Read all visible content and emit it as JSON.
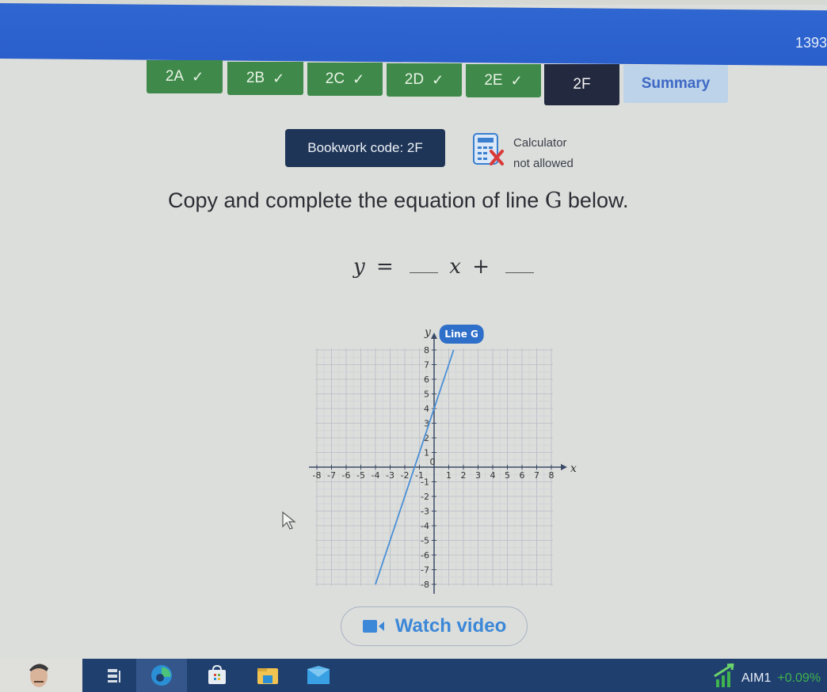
{
  "header": {
    "number_readout": "1393"
  },
  "tabs": [
    {
      "label": "2A",
      "status": "done",
      "check_icon": "checkmark-icon"
    },
    {
      "label": "2B",
      "status": "done",
      "check_icon": "checkmark-icon"
    },
    {
      "label": "2C",
      "status": "done",
      "check_icon": "checkmark-icon"
    },
    {
      "label": "2D",
      "status": "done",
      "check_icon": "checkmark-icon"
    },
    {
      "label": "2E",
      "status": "done",
      "check_icon": "checkmark-icon"
    },
    {
      "label": "2F",
      "status": "current"
    },
    {
      "label": "Summary",
      "status": "summary"
    }
  ],
  "bookwork": {
    "label": "Bookwork code: 2F"
  },
  "calculator": {
    "icon": "calculator-not-allowed-icon",
    "line1": "Calculator",
    "line2": "not allowed"
  },
  "question": {
    "text_before": "Copy and complete the equation of line ",
    "line_name": "G",
    "text_after": " below."
  },
  "equation": {
    "lhs": "y",
    "equals": "=",
    "variable": "x",
    "plus": "+"
  },
  "video_button": {
    "label": "Watch video",
    "icon": "video-camera-icon"
  },
  "colors": {
    "header_blue": "#2f66d0",
    "tab_done": "#3f8a4a",
    "tab_current": "#232a3f",
    "tab_summary": "#bcd3ea",
    "bookwork_bg": "#1f3557",
    "line_color": "#4a8fd6",
    "label_bg": "#2e6fc9",
    "video_blue": "#3b87d8"
  },
  "taskbar": {
    "icons": [
      "task-view-icon",
      "edge-browser-icon",
      "store-icon",
      "file-explorer-icon",
      "mail-icon"
    ],
    "stock_ticker": "AIM1",
    "stock_change": "+0.09%"
  },
  "chart_data": {
    "type": "line",
    "title": "",
    "xlabel": "x",
    "ylabel": "y",
    "xlim": [
      -8,
      8
    ],
    "ylim": [
      -8,
      8
    ],
    "x_ticks": [
      "-8",
      "-7",
      "-6",
      "-5",
      "-4",
      "-3",
      "-2",
      "-1",
      "0",
      "1",
      "2",
      "3",
      "4",
      "5",
      "6",
      "7",
      "8"
    ],
    "y_ticks": [
      "8",
      "7",
      "6",
      "5",
      "4",
      "3",
      "2",
      "1",
      "-1",
      "-2",
      "-3",
      "-4",
      "-5",
      "-6",
      "-7",
      "-8"
    ],
    "grid": true,
    "series": [
      {
        "name": "Line G",
        "points": [
          [
            -4,
            -8
          ],
          [
            1.333,
            8
          ]
        ],
        "slope": 3,
        "intercept": 4
      }
    ],
    "legend": {
      "label": "Line G",
      "placement": "top, near line end"
    }
  }
}
